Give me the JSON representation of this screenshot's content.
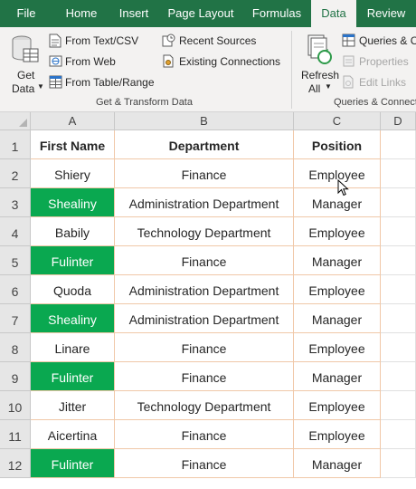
{
  "tabs": [
    {
      "label": "File",
      "active": false
    },
    {
      "label": "Home",
      "active": false
    },
    {
      "label": "Insert",
      "active": false
    },
    {
      "label": "Page Layout",
      "active": false
    },
    {
      "label": "Formulas",
      "active": false
    },
    {
      "label": "Data",
      "active": true
    },
    {
      "label": "Review",
      "active": false
    }
  ],
  "ribbon": {
    "get_data_line1": "Get",
    "get_data_line2": "Data",
    "from_text_csv": "From Text/CSV",
    "from_web": "From Web",
    "from_table_range": "From Table/Range",
    "recent_sources": "Recent Sources",
    "existing_connections": "Existing Connections",
    "group_get_transform": "Get & Transform Data",
    "refresh_line1": "Refresh",
    "refresh_line2": "All",
    "queries_connections": "Queries & Connections",
    "properties": "Properties",
    "edit_links": "Edit Links",
    "group_queries": "Queries & Connections"
  },
  "colors": {
    "tab_bar": "#217346",
    "ribbon": "#f3f2f1",
    "highlight_green": "#0aa850",
    "cell_border": "#f0c8a8"
  },
  "sheet": {
    "column_headers": [
      "A",
      "B",
      "C",
      "D"
    ],
    "row_numbers": [
      "1",
      "2",
      "3",
      "4",
      "5",
      "6",
      "7",
      "8",
      "9",
      "10",
      "11",
      "12"
    ],
    "header_row": [
      "First Name",
      "Department",
      "Position"
    ],
    "rows": [
      {
        "first_name": "Shiery",
        "department": "Finance",
        "position": "Employee",
        "highlight": false
      },
      {
        "first_name": "Shealiny",
        "department": "Administration Department",
        "position": "Manager",
        "highlight": true
      },
      {
        "first_name": "Babily",
        "department": "Technology Department",
        "position": "Employee",
        "highlight": false
      },
      {
        "first_name": "Fulinter",
        "department": "Finance",
        "position": "Manager",
        "highlight": true
      },
      {
        "first_name": "Quoda",
        "department": "Administration Department",
        "position": "Employee",
        "highlight": false
      },
      {
        "first_name": "Shealiny",
        "department": "Administration Department",
        "position": "Manager",
        "highlight": true
      },
      {
        "first_name": "Linare",
        "department": "Finance",
        "position": "Employee",
        "highlight": false
      },
      {
        "first_name": "Fulinter",
        "department": "Finance",
        "position": "Manager",
        "highlight": true
      },
      {
        "first_name": "Jitter",
        "department": "Technology Department",
        "position": "Employee",
        "highlight": false
      },
      {
        "first_name": "Aicertina",
        "department": "Finance",
        "position": "Employee",
        "highlight": false
      },
      {
        "first_name": "Fulinter",
        "department": "Finance",
        "position": "Manager",
        "highlight": true
      }
    ]
  }
}
